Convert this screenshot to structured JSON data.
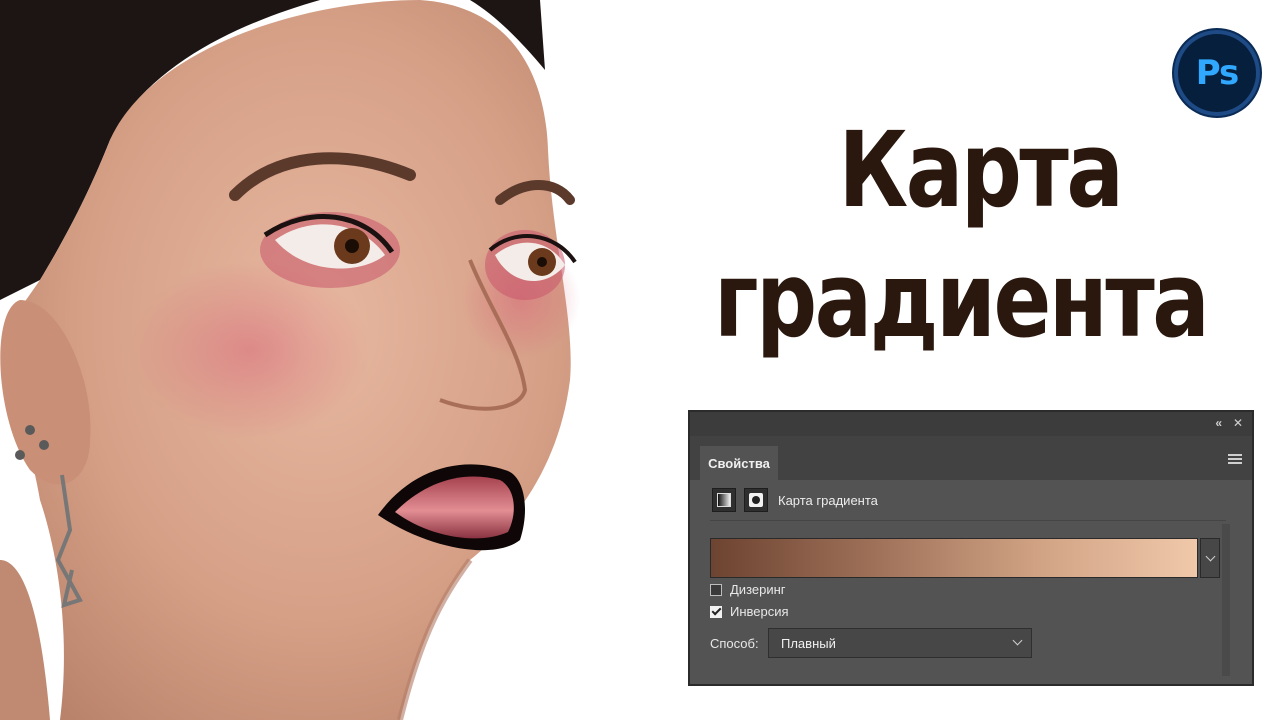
{
  "headline": {
    "line1": "Карта",
    "line2": "градиента"
  },
  "logo": {
    "text": "Ps",
    "icon": "photoshop-logo-icon"
  },
  "panel": {
    "tab_label": "Свойства",
    "adjustment_title": "Карта градиента",
    "gradient": {
      "colors": [
        "#6d4431",
        "#9e7058",
        "#d0a283",
        "#f0c8aa"
      ]
    },
    "options": {
      "dither": {
        "label": "Дизеринг",
        "checked": false
      },
      "invert": {
        "label": "Инверсия",
        "checked": true
      }
    },
    "method": {
      "label": "Способ:",
      "value": "Плавный"
    }
  },
  "colors": {
    "headline": "#2a170d",
    "panel_bg": "#535353",
    "ps_blue": "#31a8ff"
  }
}
